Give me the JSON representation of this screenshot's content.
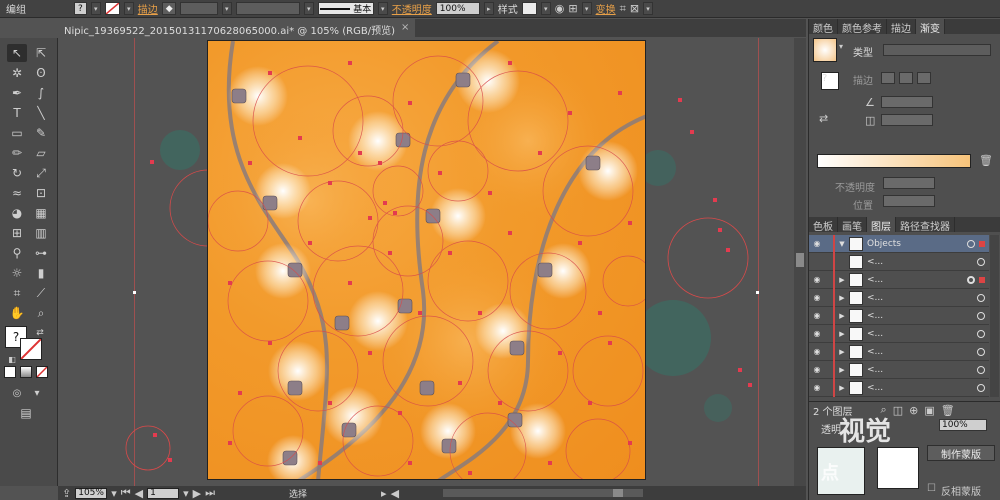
{
  "control_bar": {
    "group_label": "编组",
    "stroke_label": "描边",
    "stroke_style": "基本",
    "opacity_label": "不透明度",
    "opacity_value": "100%",
    "style_label": "样式",
    "transform_label": "变换"
  },
  "document_tab": {
    "title": "Nipic_19369522_20150131170628065000.ai* @ 105% (RGB/预览)",
    "close": "×"
  },
  "panels": {
    "top_tabs": [
      "颜色",
      "颜色参考",
      "描边",
      "渐变"
    ],
    "gradient": {
      "type_label": "类型",
      "stroke_label": "描边",
      "opacity_label": "不透明度",
      "position_label": "位置"
    },
    "layer_tabs": [
      "色板",
      "画笔",
      "图层",
      "路径查找器"
    ],
    "layers": {
      "top_layer": "Objects",
      "sub_items": [
        "<...",
        "<...",
        "<...",
        "<...",
        "<...",
        "<...",
        "<...",
        "<..."
      ],
      "footer_count": "2 个图层"
    },
    "transparency_title": "透明",
    "transparency_value": "100%",
    "make_mask_button": "制作蒙版",
    "invert_mask_label": "反相蒙版",
    "watermark": "视觉",
    "watermark_sub": "点"
  },
  "status_bar": {
    "zoom": "105%",
    "page": "1",
    "tool_status": "选择"
  },
  "colors": {
    "artboard_orange": "#f29a2b",
    "guide_red": "#e0404a",
    "ui_dark": "#535353"
  }
}
